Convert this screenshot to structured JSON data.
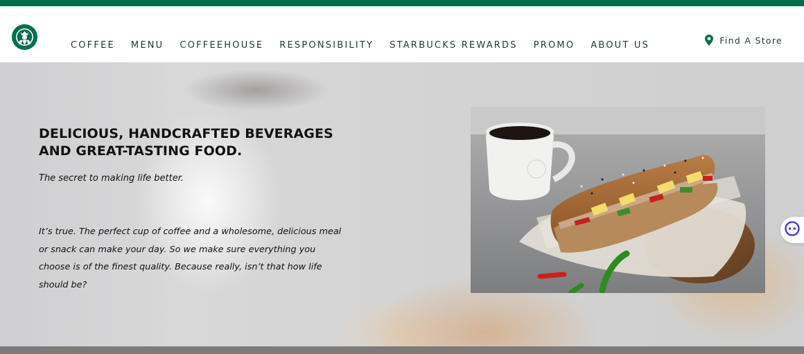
{
  "brand": {
    "name": "Starbucks",
    "logo_icon": "siren-logo-icon",
    "green": "#00704a",
    "dark_green": "#1e3932"
  },
  "nav": {
    "items": [
      {
        "label": "COFFEE"
      },
      {
        "label": "MENU"
      },
      {
        "label": "COFFEEHOUSE"
      },
      {
        "label": "RESPONSIBILITY"
      },
      {
        "label": "STARBUCKS REWARDS"
      },
      {
        "label": "PROMO"
      },
      {
        "label": "ABOUT US"
      }
    ],
    "find_store": {
      "label": "Find A Store",
      "icon": "map-pin-icon"
    }
  },
  "hero": {
    "headline": "DELICIOUS, HANDCRAFTED BEVERAGES AND GREAT-TASTING FOOD.",
    "tagline": "The secret to making life better.",
    "body": "It’s true. The perfect cup of coffee and a wholesome, delicious meal or snack can make your day. So we make sure everything you choose is of the finest quality. Because really, isn’t that how life should be?",
    "image": "coffee-cup-and-sandwich-photo"
  },
  "assistant": {
    "icon": "chat-assistant-icon"
  }
}
